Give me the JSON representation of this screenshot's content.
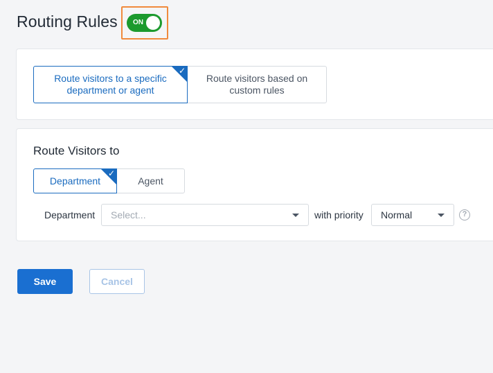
{
  "page": {
    "title": "Routing Rules",
    "toggle": {
      "label": "ON",
      "state": "on",
      "color": "#1c9a2e",
      "highlight_color": "#f08a3c"
    }
  },
  "routing_mode": {
    "options": [
      {
        "label": "Route visitors to a specific department or agent",
        "selected": true
      },
      {
        "label": "Route visitors based on custom rules",
        "selected": false
      }
    ]
  },
  "route_visitors": {
    "title": "Route Visitors to",
    "tabs": [
      {
        "label": "Department",
        "selected": true
      },
      {
        "label": "Agent",
        "selected": false
      }
    ],
    "department_label": "Department",
    "department_placeholder": "Select...",
    "priority_label": "with priority",
    "priority_value": "Normal",
    "help_icon": "question-circle-icon"
  },
  "actions": {
    "save_label": "Save",
    "cancel_label": "Cancel"
  },
  "colors": {
    "accent": "#1a6bbf",
    "primary_button": "#1a6fd1",
    "background": "#f4f5f7"
  }
}
